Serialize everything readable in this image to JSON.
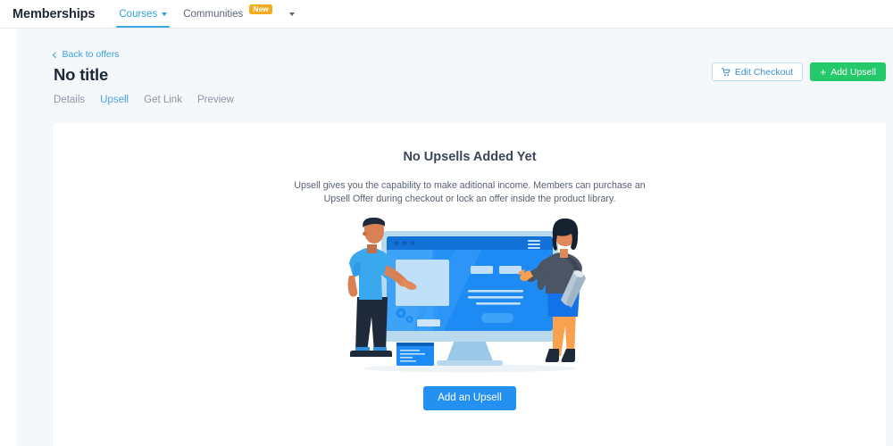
{
  "topnav": {
    "brand": "Memberships",
    "items": [
      {
        "label": "Courses",
        "active": true,
        "has_caret": true,
        "badge": ""
      },
      {
        "label": "Communities",
        "active": false,
        "has_caret": false,
        "badge": "New"
      }
    ],
    "overflow_caret": "chevron-down"
  },
  "header": {
    "back_label": "Back to offers",
    "title": "No title",
    "subtabs": [
      {
        "label": "Details",
        "active": false
      },
      {
        "label": "Upsell",
        "active": true
      },
      {
        "label": "Get Link",
        "active": false
      },
      {
        "label": "Preview",
        "active": false
      }
    ],
    "edit_checkout_label": "Edit Checkout",
    "add_upsell_label": "Add Upsell",
    "add_upsell_plus": "+"
  },
  "empty_state": {
    "title": "No Upsells Added Yet",
    "description": "Upsell gives you the capability to make aditional income. Members can purchase an Upsell Offer during checkout or lock an offer inside the product library.",
    "cta_label": "Add an Upsell",
    "illustration_alt": "two people reviewing a website on a desktop monitor"
  },
  "colors": {
    "accent_blue": "#2491f2",
    "link_blue": "#3d9fd8",
    "green": "#24c96a",
    "badge_amber": "#f4ab1e",
    "page_bg": "#f4f8fb",
    "text_dark": "#20293a",
    "text_muted": "#8b95a3"
  }
}
